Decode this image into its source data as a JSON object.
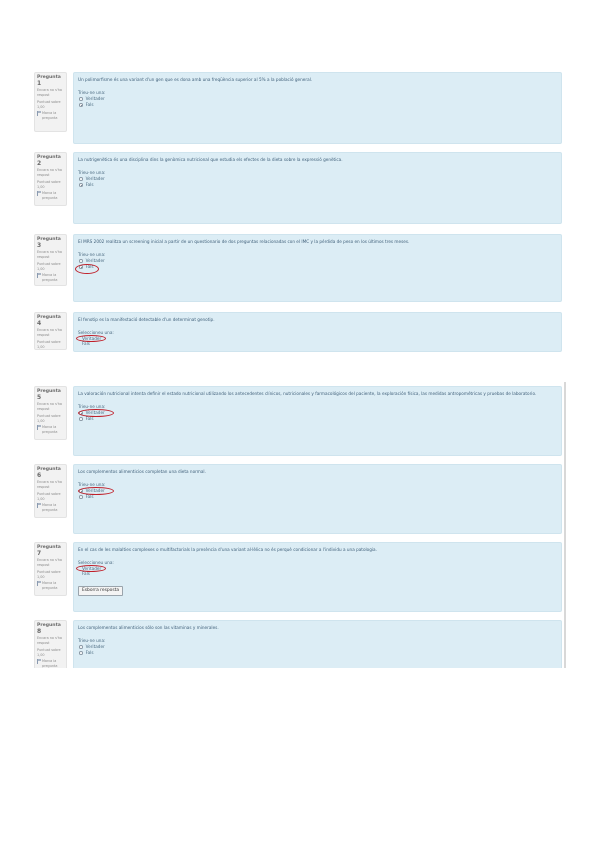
{
  "meta_labels": {
    "question_word": "Pregunta",
    "status": "Encara no s'ha respost",
    "points": "Puntuat sobre 1,00",
    "flag": "Marca la pregunta"
  },
  "sections": [
    {
      "questions": [
        {
          "number": "1",
          "text": "Un polimorfisme és una variant d'un gen que es dona amb una freqüència superior al 5% a la població general.",
          "prompt": "Trieu-ne una:",
          "type": "radio",
          "options": [
            {
              "label": "Veritader",
              "selected": false
            },
            {
              "label": "Fals",
              "selected": true
            }
          ]
        },
        {
          "number": "2",
          "text": "La nutrigenètica és una disciplina dins la genòmica nutricional que estudia els efectes de la dieta sobre la expressió genètica.",
          "prompt": "Trieu-ne una:",
          "type": "radio",
          "options": [
            {
              "label": "Veritader",
              "selected": false
            },
            {
              "label": "Fals",
              "selected": true
            }
          ]
        },
        {
          "number": "3",
          "text": "El MRS 2002 realitza un screening inicial a partir de un questionario de dos preguntas relacionadas con el IMC y la pérdida de peso en los últimos tres meses.",
          "prompt": "Trieu-ne una:",
          "type": "radio",
          "options": [
            {
              "label": "Veritader",
              "selected": false
            },
            {
              "label": "Fals",
              "selected": true
            }
          ]
        },
        {
          "number": "4",
          "text": "El fenotip es la manifestació detectable d'un determinat genotip.",
          "prompt": "Seleccioneu una:",
          "type": "select",
          "options": [
            {
              "label": "Veritader",
              "selected": true
            },
            {
              "label": "Fals",
              "selected": false
            }
          ]
        }
      ]
    },
    {
      "questions": [
        {
          "number": "5",
          "text": "La valoración nutricional intenta definir el estado nutricional utilizando los antecedentes clínicos, nutricionales y farmacológicos del paciente, la exploración física, las medidas antropométricas y pruebas de laboratorio.",
          "prompt": "Trieu-ne una:",
          "type": "radio",
          "options": [
            {
              "label": "Veritader",
              "selected": true
            },
            {
              "label": "Fals",
              "selected": false
            }
          ]
        },
        {
          "number": "6",
          "text": "Los complementos alimenticios completan una dieta normal.",
          "prompt": "Trieu-ne una:",
          "type": "radio",
          "options": [
            {
              "label": "Veritader",
              "selected": true
            },
            {
              "label": "Fals",
              "selected": false
            }
          ]
        },
        {
          "number": "7",
          "text": "En el cas de les malalties complexes o multifactorials la presència d'una variant al·lèlica no és perquè condicionar a l'individu a una patologia.",
          "prompt": "Seleccioneu una:",
          "type": "select",
          "options": [
            {
              "label": "Veritader",
              "selected": true
            },
            {
              "label": "Fals",
              "selected": false
            }
          ],
          "clear_button": "Esborra resposta"
        },
        {
          "number": "8",
          "text": "Los complementos alimenticios sólo son las vitaminas y minerales.",
          "prompt": "Trieu-ne una:",
          "type": "radio",
          "options": [
            {
              "label": "Veritader",
              "selected": false
            },
            {
              "label": "Fals",
              "selected": false
            }
          ]
        }
      ]
    }
  ]
}
